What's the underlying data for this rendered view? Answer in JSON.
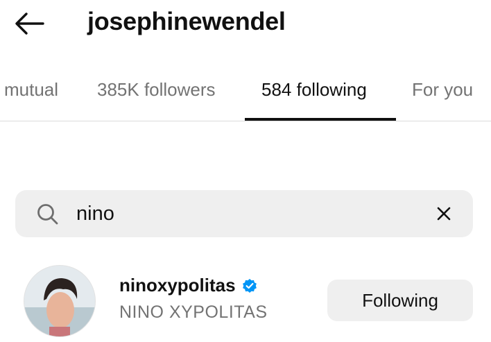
{
  "header": {
    "back_icon": "arrow-left-icon",
    "title": "josephinewendel"
  },
  "tabs": [
    {
      "label": "mutual",
      "active": false
    },
    {
      "label": "385K followers",
      "active": false
    },
    {
      "label": "584 following",
      "active": true
    },
    {
      "label": "For you",
      "active": false
    }
  ],
  "search": {
    "icon": "search-icon",
    "value": "nino",
    "clear_icon": "close-icon"
  },
  "results": [
    {
      "username": "ninoxypolitas",
      "verified": true,
      "full_name": "NINO XYPOLITAS",
      "button_label": "Following"
    }
  ],
  "colors": {
    "text_primary": "#111111",
    "text_secondary": "#737373",
    "surface": "#efefef",
    "divider": "#dbdbdb",
    "verified_blue": "#0095f6"
  }
}
